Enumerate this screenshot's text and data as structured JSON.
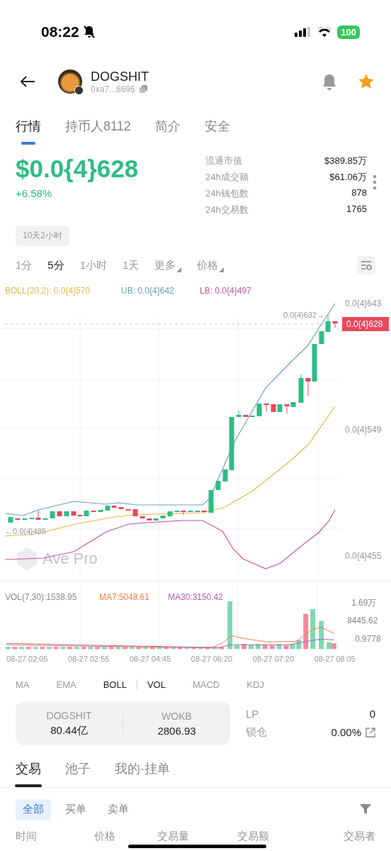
{
  "status_bar": {
    "time": "08:22",
    "battery": "100"
  },
  "header": {
    "name": "DOGSHIT",
    "address": "0xa7...8696"
  },
  "tabs": [
    {
      "label": "行情",
      "selected": true
    },
    {
      "label": "持币人8112",
      "selected": false
    },
    {
      "label": "简介",
      "selected": false
    },
    {
      "label": "安全",
      "selected": false
    }
  ],
  "price": {
    "value": "$0.0{4}628",
    "change": "+6.58%"
  },
  "stats": [
    {
      "label": "流通市值",
      "value": "$389.85万"
    },
    {
      "label": "24h成交额",
      "value": "$61.06万"
    },
    {
      "label": "24h钱包数",
      "value": "878"
    },
    {
      "label": "24h交易数",
      "value": "1765"
    }
  ],
  "age_badge": "10天2小时",
  "intervals": [
    {
      "label": "1分",
      "selected": false,
      "kind": "plain"
    },
    {
      "label": "5分",
      "selected": true,
      "kind": "plain"
    },
    {
      "label": "1小时",
      "selected": false,
      "kind": "plain"
    },
    {
      "label": "1天",
      "selected": false,
      "kind": "plain"
    },
    {
      "label": "更多",
      "selected": false,
      "kind": "dropdown"
    },
    {
      "label": "价格",
      "selected": false,
      "kind": "dropdown"
    }
  ],
  "chart": {
    "legend": [
      {
        "text": "BOLL(20,2): 0.0{4}570",
        "color": "#e3b94c"
      },
      {
        "text": "UB: 0.0{4}642",
        "color": "#6aa3b8"
      },
      {
        "text": "LB: 0.0{4}497",
        "color": "#c35a9e"
      }
    ],
    "y_labels": [
      "0.0{4}643",
      "0.0{4}549",
      "0.0{4}455"
    ],
    "current_price": "0.0{4}628",
    "high_marker": "0.0{4}632→",
    "low_marker": "←0.0{4}485",
    "watermark": "Ave Pro"
  },
  "volume": {
    "legend": [
      {
        "text": "VOL(7,30):1538.95",
        "color": "#8a8a8a"
      },
      {
        "text": "MA7:5048.61",
        "color": "#f0804a"
      },
      {
        "text": "MA30:3150.42",
        "color": "#b45cb8"
      }
    ],
    "y_labels": [
      "1.69万",
      "8445.62",
      "0.9778"
    ],
    "x_labels": [
      "08-27 02:05",
      "08-27 02:55",
      "08-27 04:45",
      "08-27 06:20",
      "08-27 07:20",
      "08-27 08:05"
    ]
  },
  "main_indicators": [
    {
      "label": "MA",
      "selected": false
    },
    {
      "label": "EMA",
      "selected": false
    },
    {
      "label": "BOLL",
      "selected": true
    }
  ],
  "sub_indicators": [
    {
      "label": "VOL",
      "selected": true
    },
    {
      "label": "MACD",
      "selected": false
    },
    {
      "label": "KDJ",
      "selected": false
    }
  ],
  "pool": {
    "tokens": [
      {
        "symbol": "DOGSHIT",
        "amount": "80.44亿"
      },
      {
        "symbol": "WOKB",
        "amount": "2806.93"
      }
    ],
    "rows": [
      {
        "label": "LP",
        "value": "0",
        "kind": "plain"
      },
      {
        "label": "锁仓",
        "value": "0.00%",
        "kind": "link"
      }
    ]
  },
  "trade_tabs": [
    {
      "label": "交易",
      "selected": true
    },
    {
      "label": "池子",
      "selected": false
    },
    {
      "label": "我的·挂单",
      "selected": false
    }
  ],
  "filters": [
    {
      "label": "全部",
      "selected": true
    },
    {
      "label": "买单",
      "selected": false
    },
    {
      "label": "卖单",
      "selected": false
    }
  ],
  "table": {
    "columns": [
      "时间",
      "价格",
      "交易量",
      "交易额",
      "交易者"
    ]
  }
}
